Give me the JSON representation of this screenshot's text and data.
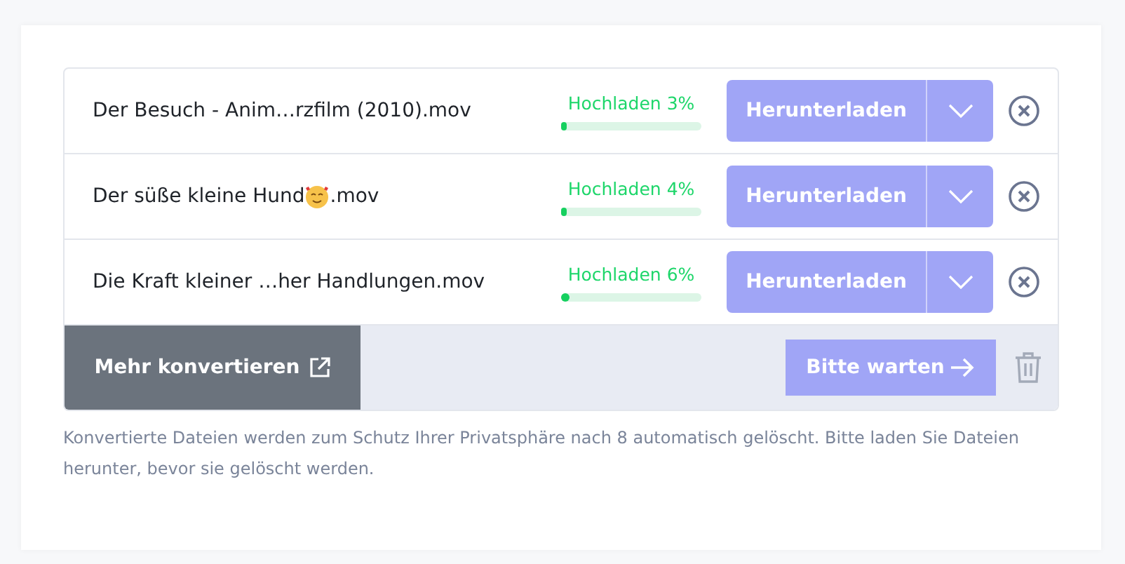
{
  "files": [
    {
      "name": "Der Besuch - Anim…rzfilm (2010).mov",
      "status": "Hochladen 3%",
      "level": 0.03,
      "button": "Herunterladen",
      "disabled": true
    },
    {
      "name": "Der süße kleine Hund",
      "emoji": true,
      "suffix": ".mov",
      "status": "Hochladen 4%",
      "level": 0.04,
      "button": "Herunterladen",
      "disabled": true
    },
    {
      "name": "Die Kraft kleiner …her Handlungen.mov",
      "status": "Hochladen 6%",
      "level": 0.06,
      "button": "Herunterladen",
      "disabled": true
    }
  ],
  "footer": {
    "more_button": "Mehr konvertieren",
    "wait_button": "Bitte warten",
    "wait_disabled": true
  },
  "notice": "Konvertierte Dateien werden zum Schutz Ihrer Privatsphäre nach 8 automatisch gelöscht. Bitte laden Sie Dateien herunter, bevor sie gelöscht werden."
}
